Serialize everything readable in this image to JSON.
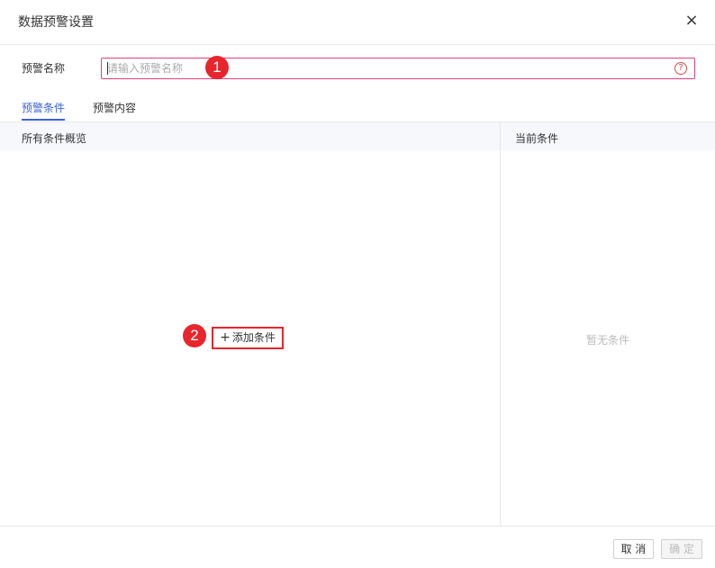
{
  "dialog": {
    "title": "数据预警设置",
    "close_icon": "×"
  },
  "name_field": {
    "label": "预警名称",
    "placeholder": "请输入预警名称",
    "value": "",
    "help_icon": "?"
  },
  "markers": [
    "1",
    "2"
  ],
  "tabs": [
    {
      "label": "预警条件",
      "active": true
    },
    {
      "label": "预警内容",
      "active": false
    }
  ],
  "left_panel": {
    "header": "所有条件概览",
    "add_button": {
      "icon": "+",
      "label": "添加条件"
    }
  },
  "right_panel": {
    "header": "当前条件",
    "empty_text": "暂无条件"
  },
  "footer": {
    "cancel_label": "取 消",
    "ok_label": "确 定"
  },
  "colors": {
    "accent": "#3a62d8",
    "marker_red": "#e8252d",
    "input_border": "#e0407a"
  }
}
